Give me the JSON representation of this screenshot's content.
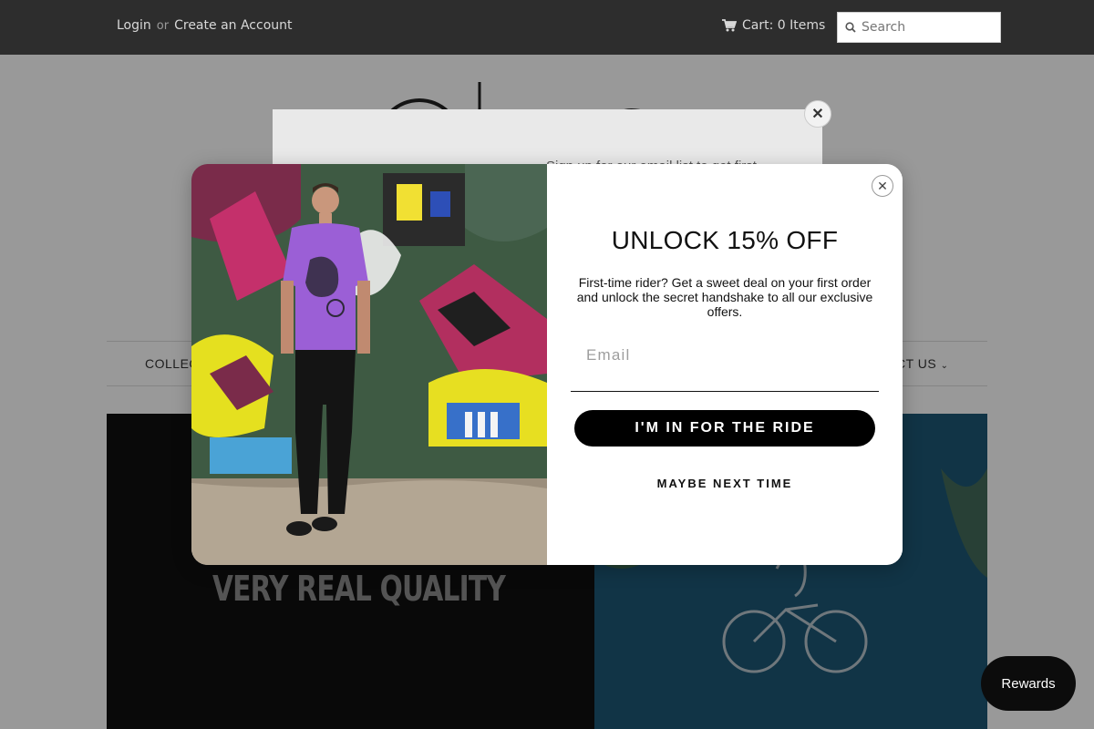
{
  "topbar": {
    "login": "Login",
    "or": "or",
    "create_account": "Create an Account",
    "cart_label": "Cart: 0 Items",
    "search_placeholder": "Search"
  },
  "nav": {
    "left_item": "COLLEC",
    "right_item": "CT US"
  },
  "hero": {
    "tagline": "VERY REAL QUALITY"
  },
  "background_popup": {
    "text": "Sign up for our email list to get first..."
  },
  "popup": {
    "title": "UNLOCK 15% OFF",
    "description": "First-time rider? Get a sweet deal on your first order and unlock the secret handshake to all our exclusive offers.",
    "email_placeholder": "Email",
    "cta_label": "I'M IN FOR THE RIDE",
    "decline_label": "MAYBE NEXT TIME"
  },
  "rewards": {
    "label": "Rewards"
  },
  "colors": {
    "topbar_bg": "#2d2d2d",
    "cta_bg": "#000000",
    "shirt": "#9b5fd6",
    "hero_right": "#1d5875"
  },
  "icons": [
    "cart-icon",
    "search-icon",
    "close-icon",
    "chevron-down-icon"
  ]
}
